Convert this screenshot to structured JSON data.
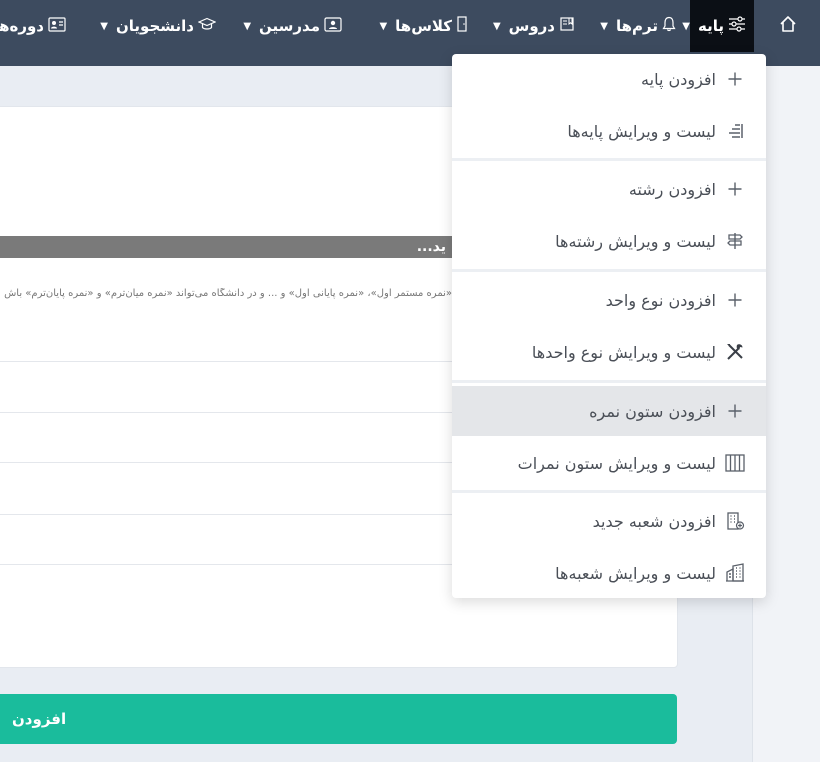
{
  "navbar": {
    "items": [
      {
        "label": "پایه",
        "icon": "sliders-icon"
      },
      {
        "label": "ترم‌ها",
        "icon": "bell-icon"
      },
      {
        "label": "دروس",
        "icon": "book-icon"
      },
      {
        "label": "کلاس‌ها",
        "icon": "door-icon"
      },
      {
        "label": "مدرسین",
        "icon": "person-card-icon"
      },
      {
        "label": "دانشجویان",
        "icon": "graduation-cap-icon"
      },
      {
        "label": "دوره‌ها",
        "icon": "id-card-icon"
      }
    ],
    "home_icon": "home-icon"
  },
  "main": {
    "gray_bar_text": "ید...",
    "hint_text": "«نمره مستمر اول»، «نمره پایانی اول» و ... و در دانشگاه می‌تواند «نمره میان‌ترم» و «نمره پایان‌ترم» باش",
    "add_button_label": "افزودن"
  },
  "dropdown": {
    "items": [
      {
        "label": "افزودن پایه",
        "icon": "plus-icon"
      },
      {
        "label": "لیست و ویرایش پایه‌ها",
        "icon": "list-levels-icon"
      },
      {
        "label": "افزودن رشته",
        "icon": "plus-icon"
      },
      {
        "label": "لیست و ویرایش رشته‌ها",
        "icon": "signpost-icon"
      },
      {
        "label": "افزودن نوع واحد",
        "icon": "plus-icon"
      },
      {
        "label": "لیست و ویرایش نوع واحدها",
        "icon": "tools-icon"
      },
      {
        "label": "افزودن ستون نمره",
        "icon": "plus-icon"
      },
      {
        "label": "لیست و ویرایش ستون نمرات",
        "icon": "columns-icon"
      },
      {
        "label": "افزودن شعبه جدید",
        "icon": "building-add-icon"
      },
      {
        "label": "لیست و ویرایش شعبه‌ها",
        "icon": "buildings-icon"
      }
    ],
    "highlighted_index": 6
  },
  "colors": {
    "navbar": "#3d4b5f",
    "active_nav": "#0b0f15",
    "accent": "#1abc9c",
    "highlight": "#e4e6e9"
  }
}
